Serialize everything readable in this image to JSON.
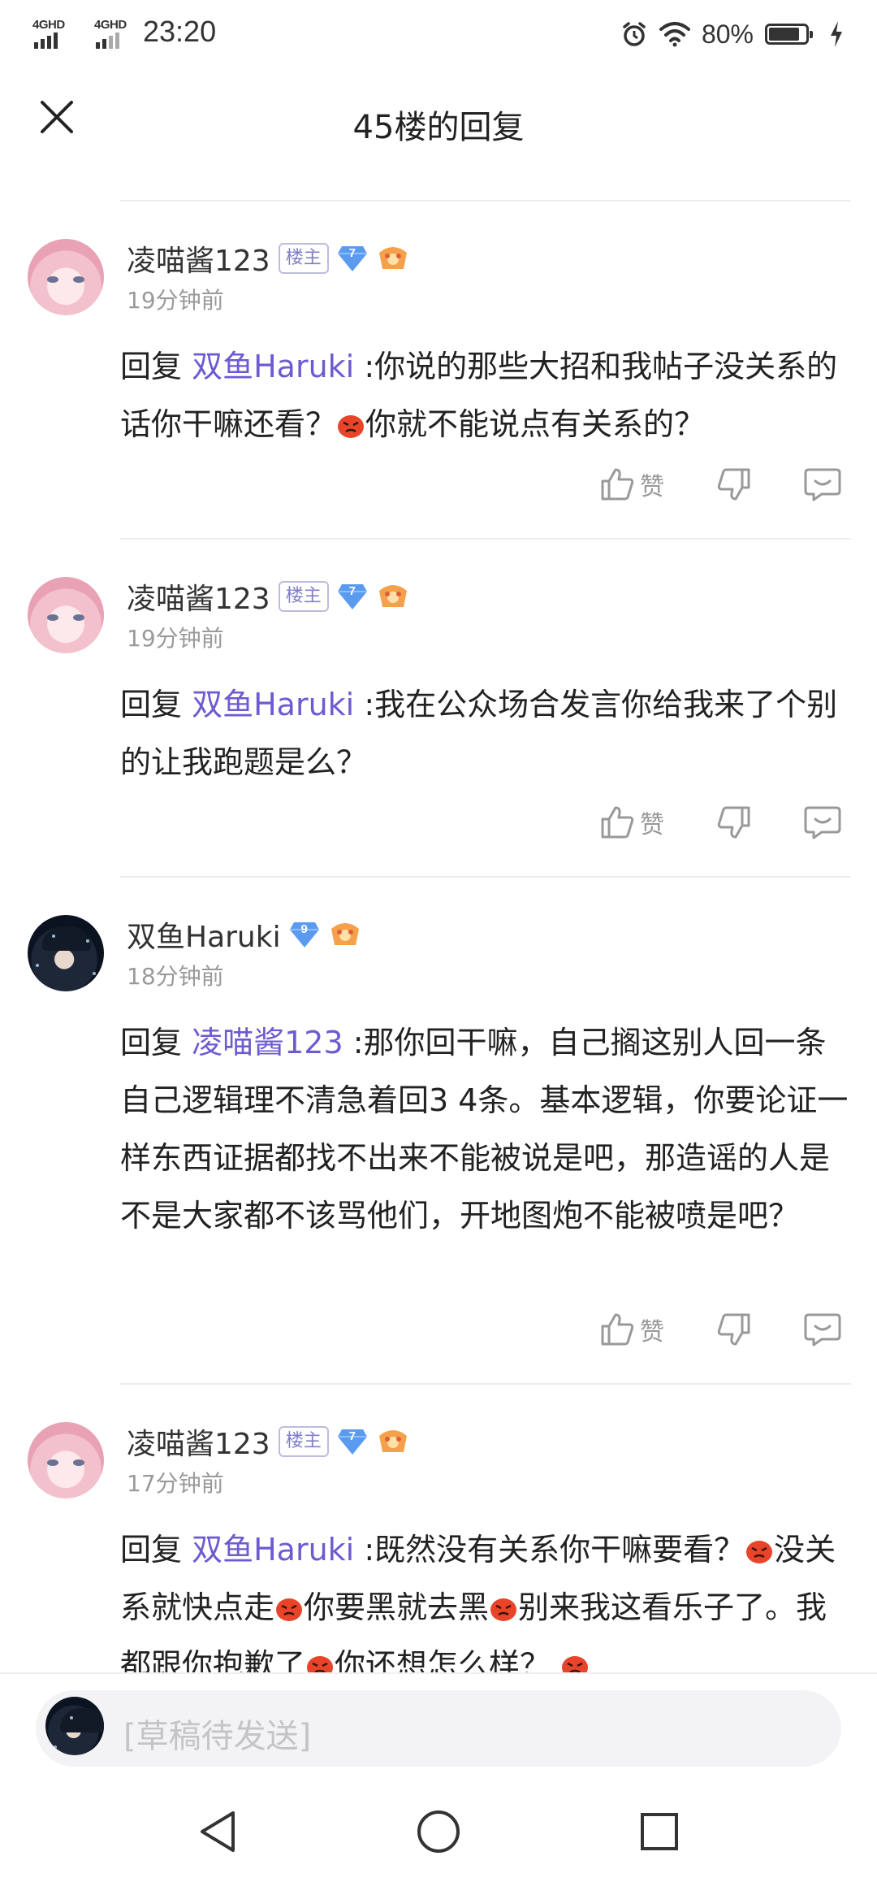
{
  "status_bar": {
    "sim1_label": "4GHD",
    "sim2_label": "4GHD",
    "time": "23:20",
    "battery_percent": "80%",
    "battery_level": 0.8,
    "icons": [
      "alarm-icon",
      "wifi-icon",
      "battery-icon",
      "charging-icon"
    ]
  },
  "header": {
    "title": "45楼的回复",
    "close_icon": "close-icon"
  },
  "comments": [
    {
      "avatar": "pink-avatar",
      "name": "凌喵酱123",
      "host_badge": "楼主",
      "level": "7",
      "time": "19分钟前",
      "reply_word": "回复",
      "reply_target": "双鱼Haruki",
      "segments": [
        ":你说的那些大招和我帖子没关系的话你干嘛还看？",
        "你就不能说点有关系的？"
      ],
      "like_label": "赞"
    },
    {
      "avatar": "pink-avatar",
      "name": "凌喵酱123",
      "host_badge": "楼主",
      "level": "7",
      "time": "19分钟前",
      "reply_word": "回复",
      "reply_target": "双鱼Haruki",
      "segments": [
        ":我在公众场合发言你给我来了个别的让我跑题是么？"
      ],
      "like_label": "赞"
    },
    {
      "avatar": "dark-avatar",
      "name": "双鱼Haruki",
      "host_badge": "",
      "level": "9",
      "time": "18分钟前",
      "reply_word": "回复",
      "reply_target": "凌喵酱123",
      "segments": [
        ":那你回干嘛，自己搁这别人回一条自己逻辑理不清急着回3 4条。基本逻辑，你要论证一样东西证据都找不出来不能被说是吧，那造谣的人是不是大家都不该骂他们，开地图炮不能被喷是吧？"
      ],
      "like_label": "赞"
    },
    {
      "avatar": "pink-avatar",
      "name": "凌喵酱123",
      "host_badge": "楼主",
      "level": "7",
      "time": "17分钟前",
      "reply_word": "回复",
      "reply_target": "双鱼Haruki",
      "segments": [
        ":既然没有关系你干嘛要看？",
        "没关系就快点走",
        "你要黑就去黑",
        "别来我这看乐子了。我都跟你抱歉了",
        "你还想怎么样？",
        ""
      ],
      "like_label": "赞"
    }
  ],
  "draft": {
    "placeholder": "[草稿待发送]"
  },
  "nav": {
    "icons": [
      "back-icon",
      "home-icon",
      "recents-icon"
    ]
  },
  "colors": {
    "accent": "#6f5ad1",
    "muted": "#9a9a9a",
    "divider": "#ececec"
  }
}
